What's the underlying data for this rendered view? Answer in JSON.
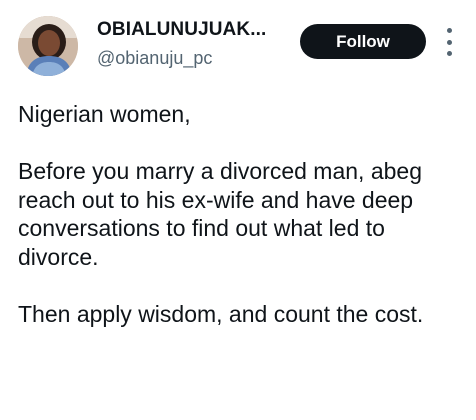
{
  "author": {
    "display_name": "OBIALUNUJUAK...",
    "handle": "@obianuju_pc"
  },
  "actions": {
    "follow_label": "Follow",
    "more_icon": "more-vertical-icon"
  },
  "tweet": {
    "paragraphs": [
      "Nigerian women,",
      "Before you marry a divorced man, abeg reach out to his ex-wife and have deep conversations to find out what led to divorce.",
      "Then apply wisdom, and count the cost."
    ]
  },
  "colors": {
    "text": "#0f1419",
    "secondary": "#536471",
    "button_bg": "#0f1419",
    "button_text": "#ffffff",
    "background": "#ffffff"
  }
}
